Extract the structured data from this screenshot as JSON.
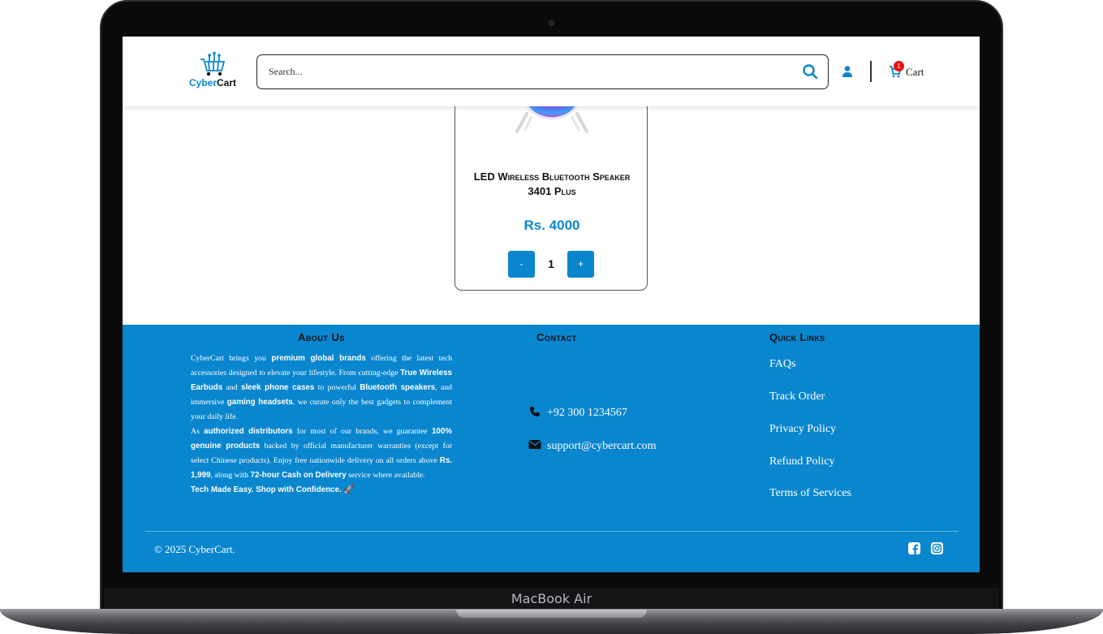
{
  "device": {
    "label": "MacBook Air"
  },
  "header": {
    "logo": {
      "prefix": "Cyber",
      "suffix": "Cart"
    },
    "search": {
      "placeholder": "Search..."
    },
    "cart": {
      "label": "Cart",
      "count": "1"
    }
  },
  "product": {
    "name": "LED Wireless Bluetooth Speaker 3401 Plus",
    "price": "Rs. 4000",
    "quantity": "1",
    "minus_label": "-",
    "plus_label": "+"
  },
  "footer": {
    "about": {
      "title": "About Us",
      "p1_parts": [
        "CyberCart brings you ",
        "premium global brands",
        " offering the latest tech accessories designed to elevate your lifestyle. From cutting-edge ",
        "True Wireless Earbuds",
        " and ",
        "sleek phone cases",
        " to powerful ",
        "Bluetooth speakers",
        ", and immersive ",
        "gaming headsets",
        ", we curate only the best gadgets to complement your daily life."
      ],
      "p2_parts": [
        "As ",
        "authorized distributors",
        " for most of our brands, we guarantee ",
        "100% genuine products",
        " backed by official manufacturer warranties (except for select Chinese products). Enjoy free nationwide delivery on all orders above ",
        "Rs. 1,999",
        ", along with ",
        "72-hour Cash on Delivery",
        " service where available."
      ],
      "tagline": "Tech Made Easy. Shop with Confidence. 🚀"
    },
    "contact": {
      "title": "Contact",
      "phone": "+92 300 1234567",
      "email": "support@cybercart.com"
    },
    "quick_links": {
      "title": "Quick Links",
      "items": [
        "FAQs",
        "Track Order",
        "Privacy Policy",
        "Refund Policy",
        "Terms of Services"
      ]
    },
    "copyright": "© 2025 CyberCart.",
    "social_icons": [
      "facebook-icon",
      "instagram-icon"
    ]
  },
  "colors": {
    "brand": "#0a86cf",
    "badge": "#ee1111"
  }
}
